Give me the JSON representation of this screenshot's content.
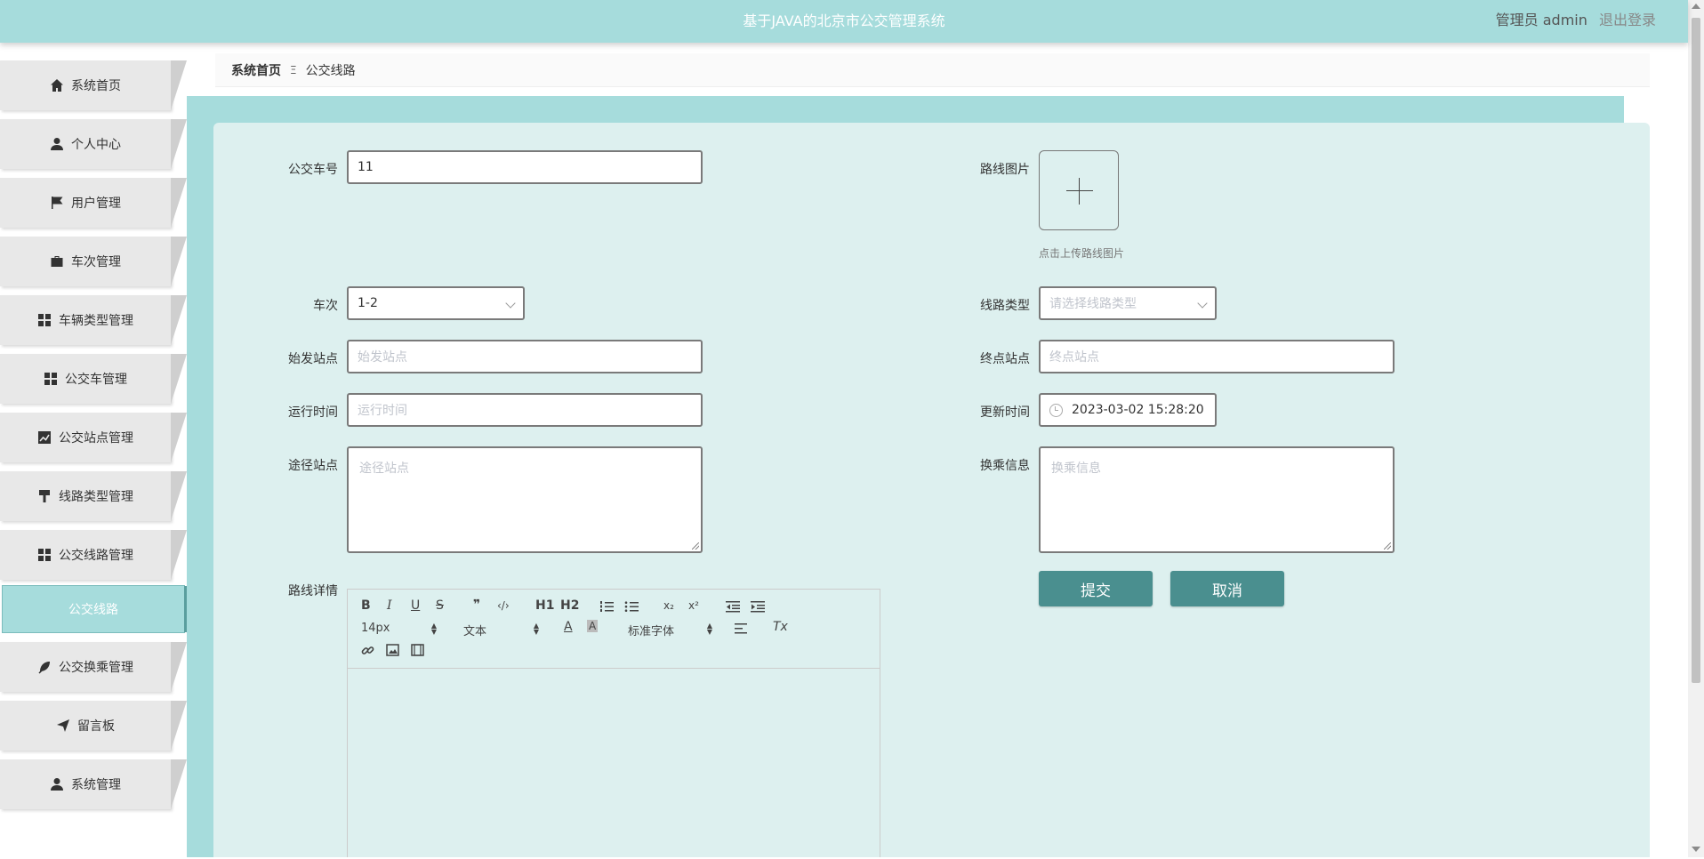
{
  "header": {
    "title": "基于JAVA的北京市公交管理系统",
    "user_label": "管理员 admin",
    "logout_label": "退出登录"
  },
  "sidebar": {
    "items": [
      {
        "label": "系统首页",
        "icon": "home-icon"
      },
      {
        "label": "个人中心",
        "icon": "user-icon"
      },
      {
        "label": "用户管理",
        "icon": "flag-icon"
      },
      {
        "label": "车次管理",
        "icon": "briefcase-icon"
      },
      {
        "label": "车辆类型管理",
        "icon": "grid-icon"
      },
      {
        "label": "公交车管理",
        "icon": "grid-icon"
      },
      {
        "label": "公交站点管理",
        "icon": "chart-icon"
      },
      {
        "label": "线路类型管理",
        "icon": "brush-icon"
      },
      {
        "label": "公交线路管理",
        "icon": "grid-icon"
      },
      {
        "label": "公交换乘管理",
        "icon": "leaf-icon"
      },
      {
        "label": "留言板",
        "icon": "send-icon"
      },
      {
        "label": "系统管理",
        "icon": "user-icon"
      }
    ],
    "active_sub": "公交线路"
  },
  "breadcrumb": {
    "home": "系统首页",
    "separator": "Ξ",
    "current": "公交线路"
  },
  "form": {
    "bus_no": {
      "label": "公交车号",
      "value": "11"
    },
    "route_image": {
      "label": "路线图片",
      "tip": "点击上传路线图片"
    },
    "trip": {
      "label": "车次",
      "value": "1-2"
    },
    "route_type": {
      "label": "线路类型",
      "placeholder": "请选择线路类型"
    },
    "start_station": {
      "label": "始发站点",
      "placeholder": "始发站点"
    },
    "end_station": {
      "label": "终点站点",
      "placeholder": "终点站点"
    },
    "run_time": {
      "label": "运行时间",
      "placeholder": "运行时间"
    },
    "update_time": {
      "label": "更新时间",
      "value": "2023-03-02 15:28:20"
    },
    "via_stations": {
      "label": "途径站点",
      "placeholder": "途径站点"
    },
    "transfer_info": {
      "label": "换乘信息",
      "placeholder": "换乘信息"
    },
    "route_detail": {
      "label": "路线详情"
    },
    "submit_label": "提交",
    "cancel_label": "取消"
  },
  "editor": {
    "font_size": "14px",
    "header_type": "文本",
    "font_family": "标准字体",
    "glyphs": {
      "bold": "B",
      "italic": "I",
      "underline": "U",
      "strike": "S",
      "quote": "❞",
      "code": "‹/›",
      "h1": "H1",
      "h2": "H2",
      "sub": "x₂",
      "sup": "x²",
      "color": "A",
      "clean": "Tx"
    }
  }
}
